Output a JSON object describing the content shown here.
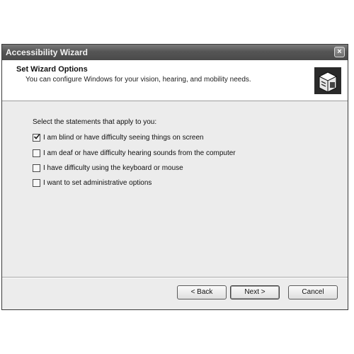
{
  "window": {
    "title": "Accessibility Wizard",
    "close_glyph": "×"
  },
  "header": {
    "title": "Set Wizard Options",
    "subtitle": "You can configure Windows for your vision, hearing, and mobility needs.",
    "icon": "accessibility-wizard-icon"
  },
  "main": {
    "prompt": "Select the statements that apply to you:",
    "options": [
      {
        "label": "I am blind or have difficulty seeing things on screen",
        "checked": true
      },
      {
        "label": "I am deaf or have difficulty hearing sounds from the computer",
        "checked": false
      },
      {
        "label": "I have difficulty using the keyboard or mouse",
        "checked": false
      },
      {
        "label": "I want to set administrative options",
        "checked": false
      }
    ]
  },
  "buttons": {
    "back": "< Back",
    "next": "Next >",
    "cancel": "Cancel"
  }
}
